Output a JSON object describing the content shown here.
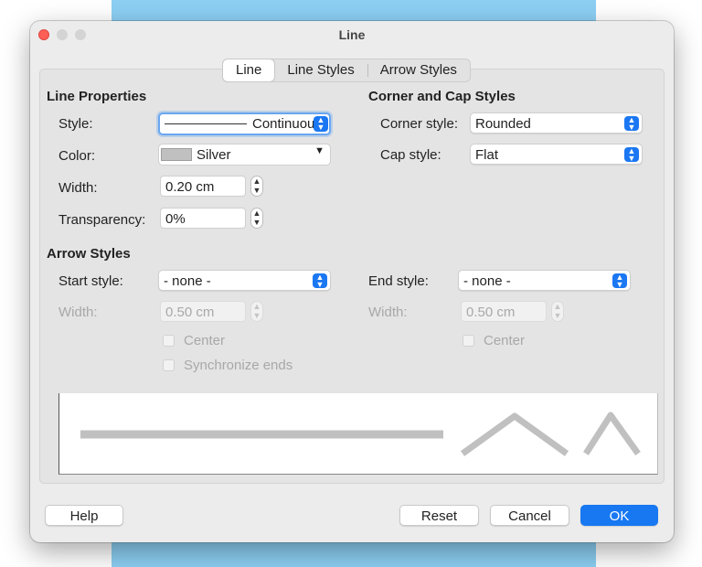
{
  "dialog": {
    "title": "Line"
  },
  "tabs": [
    {
      "label": "Line",
      "active": true
    },
    {
      "label": "Line Styles",
      "active": false
    },
    {
      "label": "Arrow Styles",
      "active": false
    }
  ],
  "line_properties": {
    "heading": "Line Properties",
    "style_label": "Style:",
    "style_value": "Continuous",
    "color_label": "Color:",
    "color_value": "Silver",
    "color_hex": "#c0c0c0",
    "width_label": "Width:",
    "width_value": "0.20 cm",
    "transparency_label": "Transparency:",
    "transparency_value": "0%"
  },
  "corner_cap": {
    "heading": "Corner and Cap Styles",
    "corner_label": "Corner style:",
    "corner_value": "Rounded",
    "cap_label": "Cap style:",
    "cap_value": "Flat"
  },
  "arrow_styles": {
    "heading": "Arrow Styles",
    "start_label": "Start style:",
    "start_value": "- none -",
    "start_width_label": "Width:",
    "start_width_value": "0.50 cm",
    "start_center_label": "Center",
    "sync_label": "Synchronize ends",
    "end_label": "End style:",
    "end_value": "- none -",
    "end_width_label": "Width:",
    "end_width_value": "0.50 cm",
    "end_center_label": "Center"
  },
  "buttons": {
    "help": "Help",
    "reset": "Reset",
    "cancel": "Cancel",
    "ok": "OK"
  },
  "colors": {
    "accent": "#1778f2",
    "close_light": "#fe5f57",
    "preview_line": "#c0c0c0"
  }
}
